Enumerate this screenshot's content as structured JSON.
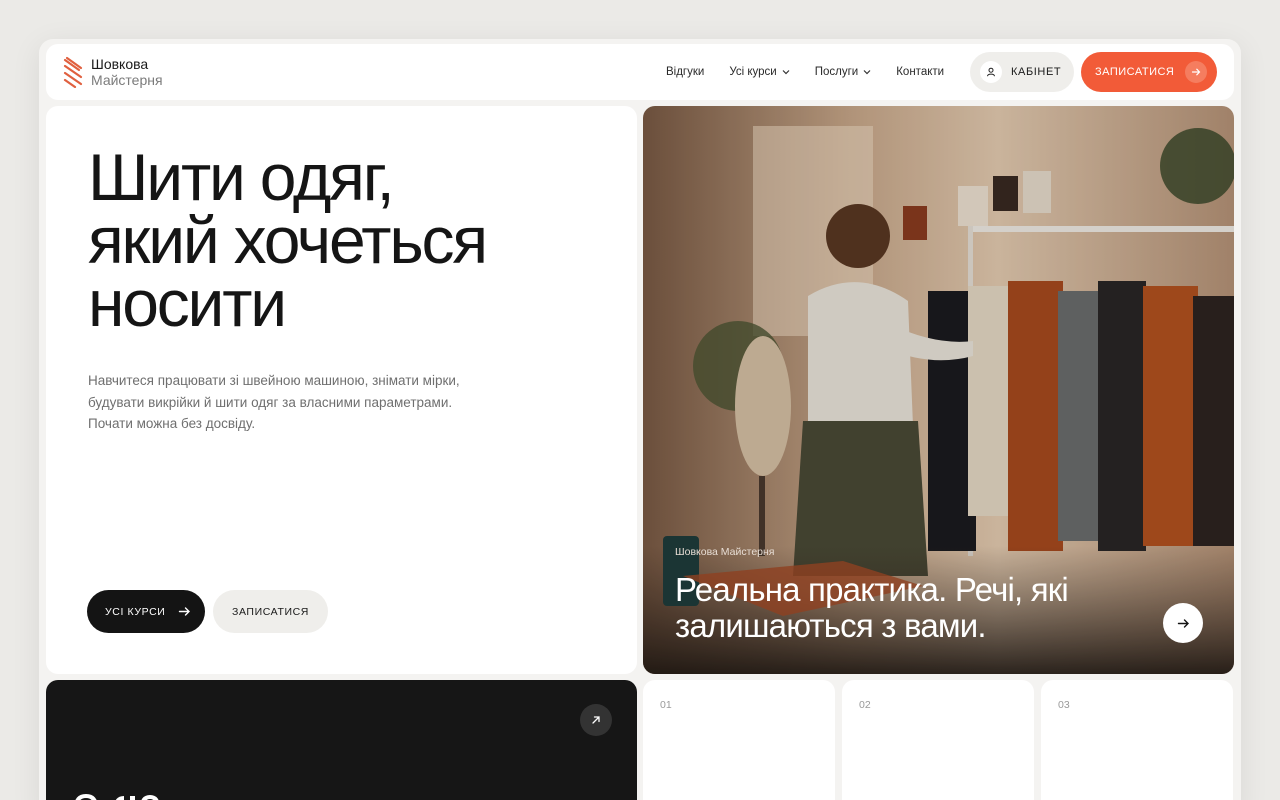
{
  "brand": {
    "line1": "Шовкова",
    "line2": "Майстерня",
    "accent": "#f25b38"
  },
  "nav": {
    "items": [
      {
        "label": "Відгуки",
        "has_dropdown": false
      },
      {
        "label": "Усі курси",
        "has_dropdown": true
      },
      {
        "label": "Послуги",
        "has_dropdown": true
      },
      {
        "label": "Контакти",
        "has_dropdown": false
      }
    ],
    "cabinet_label": "КАБІНЕТ",
    "signup_label": "ЗАПИСАТИСЯ"
  },
  "hero": {
    "title_lines": [
      "Шити одяг,",
      "який хочеться",
      "носити"
    ],
    "subtitle_lines": [
      "Навчитеся працювати зі швейною машиною, знімати мірки,",
      "будувати викрійки й шити одяг за власними параметрами.",
      "Почати можна без досвіду."
    ],
    "primary_button": "УСІ КУРСИ",
    "secondary_button": "ЗАПИСАТИСЯ"
  },
  "feature_image": {
    "kicker": "Шовкова Майстерня",
    "caption_lines": [
      "Реальна практика. Речі, які",
      "залишаються з вами."
    ],
    "alt": "atelier-photo"
  },
  "cards": [
    {
      "number": "01"
    },
    {
      "number": "02"
    },
    {
      "number": "03"
    }
  ],
  "icons": {
    "logo": "stripes-logo-icon",
    "dropdown": "chevron-down-icon",
    "user": "user-icon",
    "arrow": "arrow-right-icon",
    "external": "arrow-up-right-icon"
  }
}
